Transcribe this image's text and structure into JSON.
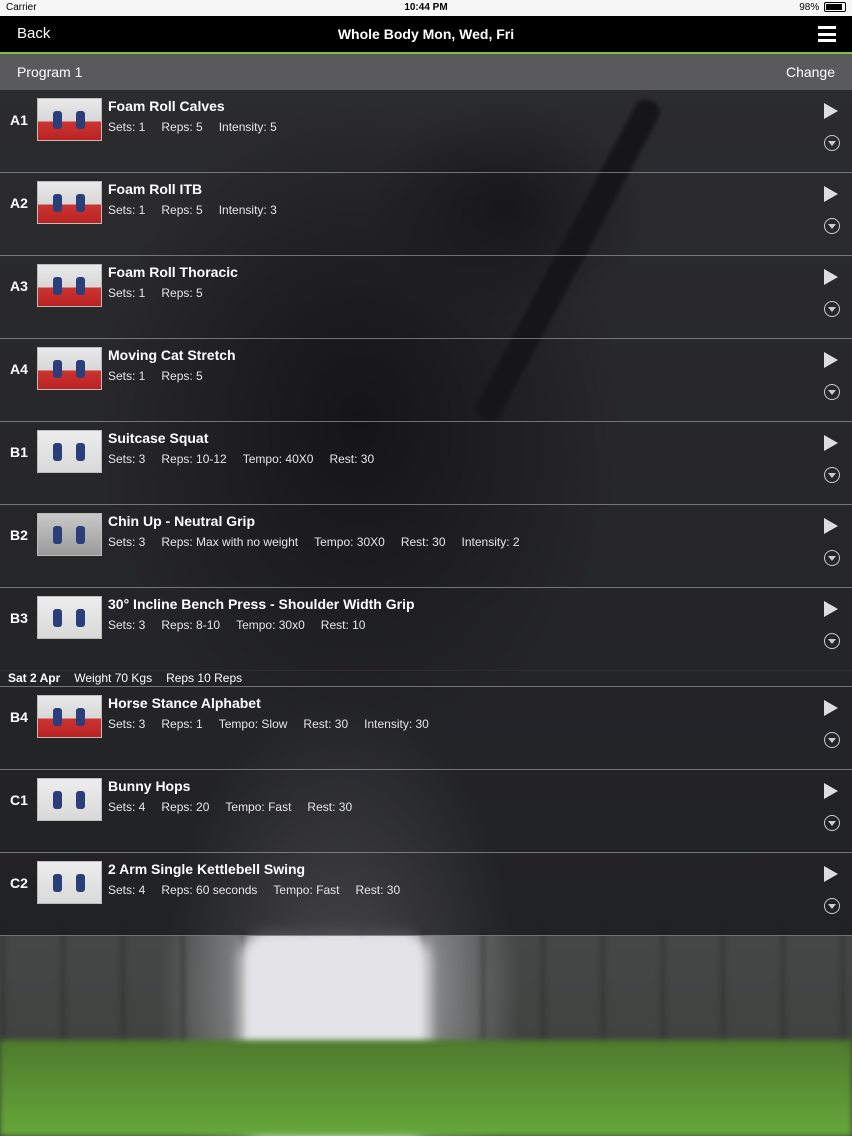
{
  "status": {
    "carrier": "Carrier",
    "time": "10:44 PM",
    "battery": "98%"
  },
  "nav": {
    "back_label": "Back",
    "title": "Whole Body Mon, Wed, Fri"
  },
  "program": {
    "name": "Program 1",
    "change_label": "Change"
  },
  "exercises": [
    {
      "code": "A1",
      "name": "Foam Roll Calves",
      "stats": [
        "Sets: 1",
        "Reps: 5",
        "Intensity: 5"
      ]
    },
    {
      "code": "A2",
      "name": "Foam Roll ITB",
      "stats": [
        "Sets: 1",
        "Reps: 5",
        "Intensity: 3"
      ]
    },
    {
      "code": "A3",
      "name": "Foam Roll Thoracic",
      "stats": [
        "Sets: 1",
        "Reps: 5"
      ]
    },
    {
      "code": "A4",
      "name": "Moving Cat Stretch",
      "stats": [
        "Sets: 1",
        "Reps: 5"
      ]
    },
    {
      "code": "B1",
      "name": "Suitcase Squat",
      "stats": [
        "Sets: 3",
        "Reps: 10-12",
        "Tempo: 40X0",
        "Rest: 30"
      ]
    },
    {
      "code": "B2",
      "name": "Chin Up - Neutral Grip",
      "stats": [
        "Sets: 3",
        "Reps: Max with no weight",
        "Tempo: 30X0",
        "Rest: 30",
        "Intensity: 2"
      ]
    },
    {
      "code": "B3",
      "name": "30° Incline Bench Press - Shoulder Width Grip",
      "stats": [
        "Sets: 3",
        "Reps: 8-10",
        "Tempo: 30x0",
        "Rest: 10"
      ]
    },
    {
      "code": "B4",
      "name": "Horse Stance Alphabet",
      "stats": [
        "Sets: 3",
        "Reps: 1",
        "Tempo: Slow",
        "Rest: 30",
        "Intensity: 30"
      ]
    },
    {
      "code": "C1",
      "name": "Bunny Hops",
      "stats": [
        "Sets: 4",
        "Reps: 20",
        "Tempo: Fast",
        "Rest: 30"
      ]
    },
    {
      "code": "C2",
      "name": "2 Arm Single Kettlebell Swing",
      "stats": [
        "Sets: 4",
        "Reps: 60 seconds",
        "Tempo: Fast",
        "Rest: 30"
      ]
    }
  ],
  "history_b3": {
    "date": "Sat 2 Apr",
    "weight": "Weight 70 Kgs",
    "reps": "Reps 10 Reps"
  },
  "icons": {
    "play": "play-icon",
    "expand": "chevron-down-circle-icon",
    "menu": "hamburger-menu-icon"
  },
  "colors": {
    "accent": "#7bc043"
  }
}
